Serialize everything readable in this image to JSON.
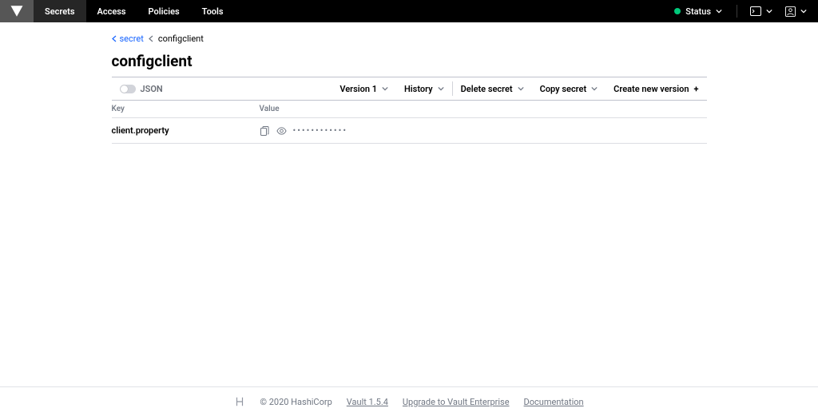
{
  "nav": {
    "items": [
      {
        "label": "Secrets",
        "active": true
      },
      {
        "label": "Access",
        "active": false
      },
      {
        "label": "Policies",
        "active": false
      },
      {
        "label": "Tools",
        "active": false
      }
    ],
    "status_label": "Status"
  },
  "breadcrumb": {
    "link_label": "secret",
    "current": "configclient"
  },
  "page": {
    "title": "configclient"
  },
  "toolbar": {
    "json_label": "JSON",
    "version_label": "Version 1",
    "history_label": "History",
    "delete_label": "Delete secret",
    "copy_label": "Copy secret",
    "create_label": "Create new version"
  },
  "table": {
    "header_key": "Key",
    "header_value": "Value",
    "rows": [
      {
        "key": "client.property",
        "masked": "••••••••••••"
      }
    ]
  },
  "footer": {
    "copyright": "© 2020 HashiCorp",
    "version": "Vault 1.5.4",
    "upgrade": "Upgrade to Vault Enterprise",
    "docs": "Documentation"
  }
}
